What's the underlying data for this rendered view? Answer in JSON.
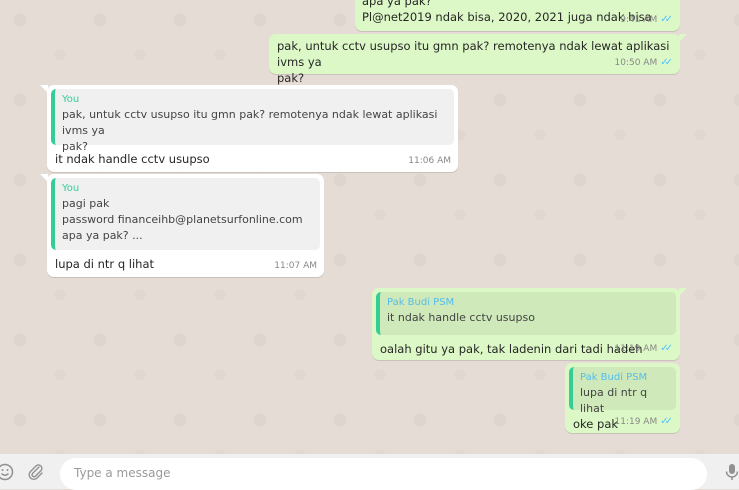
{
  "messages": [
    {
      "text": "apa ya pak?\nPl@net2019 ndak bisa, 2020, 2021 juga ndak bisa",
      "time": "9:41 AM"
    },
    {
      "text": "pak, untuk cctv usupso itu gmn pak? remotenya ndak lewat aplikasi ivms ya\npak?",
      "time": "10:50 AM"
    },
    {
      "quote_author": "You",
      "quote_text": "pak, untuk cctv usupso itu gmn pak? remotenya ndak lewat aplikasi ivms ya\npak?",
      "text": "it ndak handle cctv usupso",
      "time": "11:06 AM"
    },
    {
      "quote_author": "You",
      "quote_text": "pagi pak\npassword financeihb@planetsurfonline.com\napa ya pak? ...",
      "text": "lupa di ntr q lihat",
      "time": "11:07 AM"
    },
    {
      "quote_author": "Pak Budi PSM",
      "quote_text": "it ndak handle cctv usupso",
      "text": "oalah gitu ya pak, tak ladenin dari tadi hadeh",
      "time": "11:19 AM"
    },
    {
      "quote_author": "Pak Budi PSM",
      "quote_text": "lupa di ntr q lihat",
      "text": "oke pak",
      "time": "11:19 AM"
    }
  ],
  "composer": {
    "placeholder": "Type a message",
    "icons": [
      "emoji-icon",
      "attach-icon",
      "microphone-icon"
    ]
  },
  "colors": {
    "outgoing_bubble": "#dcf8c6",
    "incoming_bubble": "#ffffff",
    "quote_bar": "#35cd96",
    "read_ticks": "#4fc3f7",
    "chat_background": "#e5ddd5"
  }
}
